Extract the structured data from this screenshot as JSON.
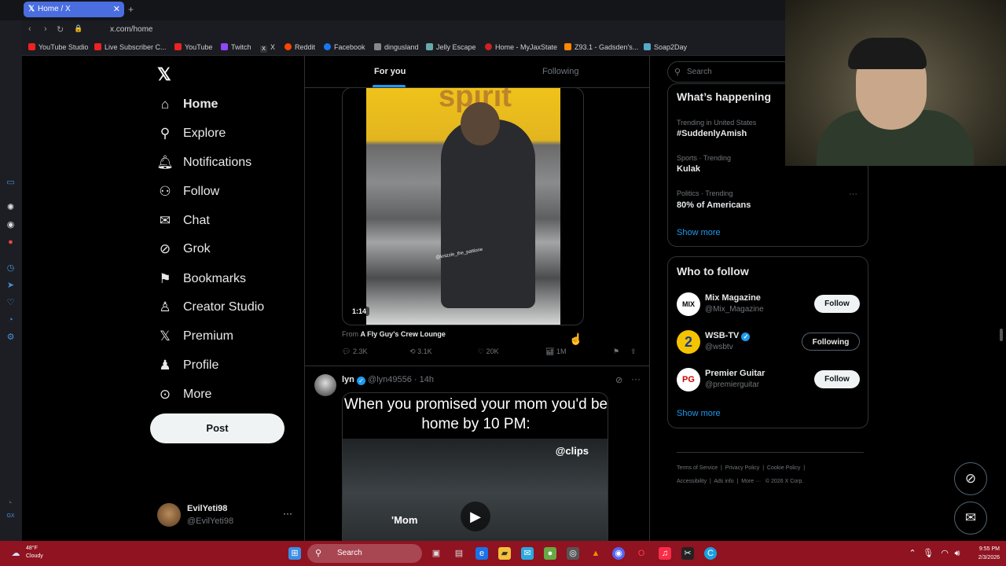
{
  "browser": {
    "tab_title": "Home / X",
    "address": "x.com/home",
    "bookmarks": [
      "YouTube Studio",
      "Live Subscriber C...",
      "YouTube",
      "Twitch",
      "X",
      "Reddit",
      "Facebook",
      "dingusland",
      "Jelly Escape",
      "Home - MyJaxState",
      "Z93.1 - Gadsden's...",
      "Soap2Day"
    ]
  },
  "nav": {
    "items": [
      {
        "label": "Home",
        "icon": "home-icon"
      },
      {
        "label": "Explore",
        "icon": "search-icon"
      },
      {
        "label": "Notifications",
        "icon": "bell-icon"
      },
      {
        "label": "Follow",
        "icon": "person-add-icon"
      },
      {
        "label": "Chat",
        "icon": "mail-icon"
      },
      {
        "label": "Grok",
        "icon": "grok-icon"
      },
      {
        "label": "Bookmarks",
        "icon": "bookmark-icon"
      },
      {
        "label": "Creator Studio",
        "icon": "creator-icon"
      },
      {
        "label": "Premium",
        "icon": "x-icon"
      },
      {
        "label": "Profile",
        "icon": "person-icon"
      },
      {
        "label": "More",
        "icon": "more-icon"
      }
    ],
    "post_label": "Post"
  },
  "account": {
    "name": "EvilYeti98",
    "handle": "@EvilYeti98"
  },
  "feed": {
    "tabs": [
      "For you",
      "Following"
    ],
    "post1": {
      "watermark": "spirit",
      "video_watermark": "@knizzle_the_pattione",
      "duration": "1:14",
      "from_label": "From",
      "community": "A Fly Guy's Crew Lounge",
      "replies": "2.3K",
      "reposts": "3.1K",
      "likes": "20K",
      "views": "1M"
    },
    "post2": {
      "name": "lyn",
      "handle": "@lyn49556",
      "time": "14h",
      "caption": "When you promised your mom you'd be home by 10 PM:",
      "clips_tag": "@clips",
      "overlay_text": "'Mom"
    }
  },
  "sidebar": {
    "search_placeholder": "Search",
    "happening": {
      "title": "What’s happening",
      "trends": [
        {
          "meta": "Trending in United States",
          "tag": "#SuddenlyAmish"
        },
        {
          "meta": "Sports · Trending",
          "tag": "Kulak"
        },
        {
          "meta": "Politics · Trending",
          "tag": "80% of Americans"
        }
      ],
      "show_more": "Show more"
    },
    "who_to_follow": {
      "title": "Who to follow",
      "accounts": [
        {
          "name": "Mix Magazine",
          "handle": "@Mix_Magazine",
          "button": "Follow",
          "avatar": "MIX"
        },
        {
          "name": "WSB-TV",
          "handle": "@wsbtv",
          "button": "Following",
          "avatar": "2"
        },
        {
          "name": "Premier Guitar",
          "handle": "@premierguitar",
          "button": "Follow",
          "avatar": "PG"
        }
      ],
      "show_more": "Show more"
    },
    "footer": {
      "line1": [
        "Terms of Service",
        "Privacy Policy",
        "Cookie Policy"
      ],
      "line2": [
        "Accessibility",
        "Ads info",
        "More ···",
        "© 2026 X Corp."
      ]
    }
  },
  "taskbar": {
    "weather_temp": "48°F",
    "weather_desc": "Cloudy",
    "search_label": "Search",
    "time": "9:55 PM",
    "date": "2/3/2026"
  }
}
